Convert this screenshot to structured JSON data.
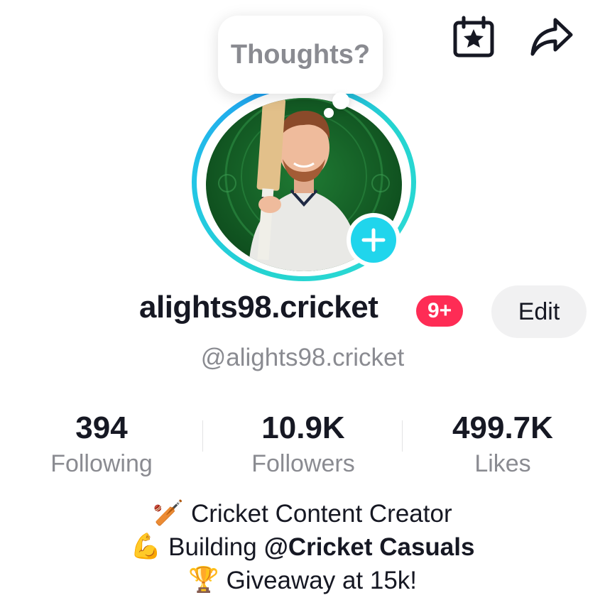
{
  "header": {
    "calendar_icon": "calendar-star-icon",
    "share_icon": "share-arrow-icon"
  },
  "thought_bubble": {
    "text": "Thoughts?"
  },
  "profile": {
    "username": "alights98.cricket",
    "notification_badge": "9+",
    "edit_label": "Edit",
    "handle": "@alights98.cricket"
  },
  "stats": [
    {
      "value": "394",
      "label": "Following"
    },
    {
      "value": "10.9K",
      "label": "Followers"
    },
    {
      "value": "499.7K",
      "label": "Likes"
    }
  ],
  "bio": {
    "line1_emoji": "🏏",
    "line1_text": "Cricket Content Creator",
    "line2_emoji": "💪",
    "line2_prefix": "Building",
    "line2_mention": "@Cricket Casuals",
    "line3_emoji": "🏆",
    "line3_text": "Giveaway at 15k!"
  },
  "colors": {
    "accent": "#20d5ec",
    "badge": "#fe2c55",
    "text_primary": "#161823",
    "text_secondary": "#8a8b91"
  }
}
